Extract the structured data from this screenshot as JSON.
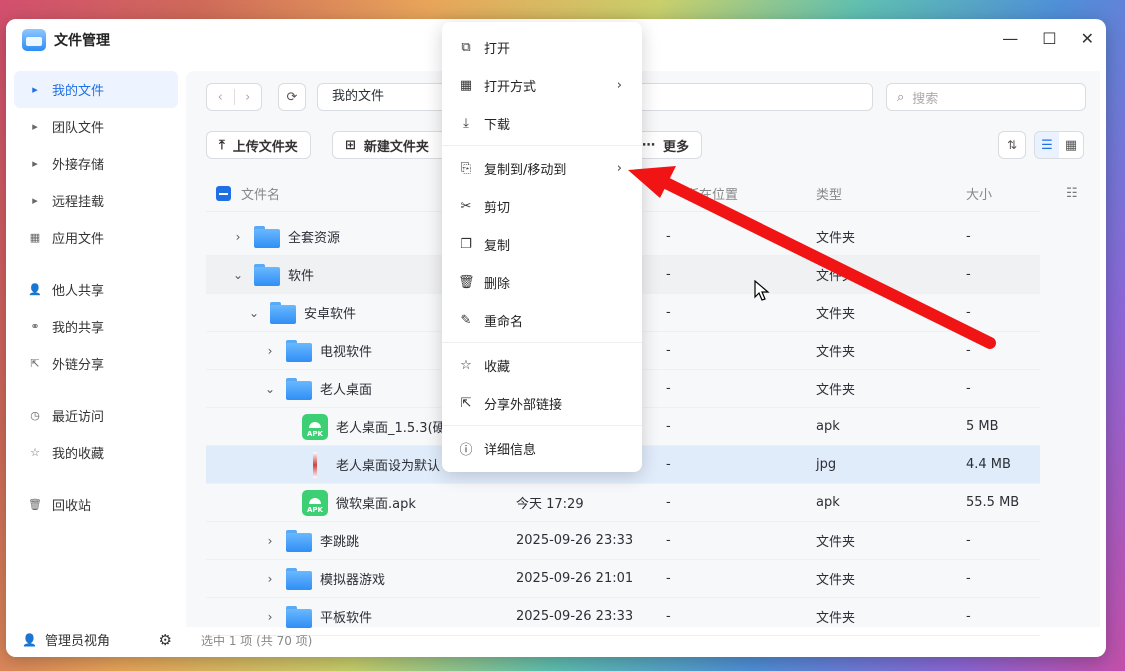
{
  "app": {
    "title": "文件管理"
  },
  "sidebar": {
    "items": [
      {
        "label": "我的文件",
        "icon": "caret-right-icon",
        "active": true
      },
      {
        "label": "团队文件",
        "icon": "caret-right-icon"
      },
      {
        "label": "外接存储",
        "icon": "caret-right-icon"
      },
      {
        "label": "远程挂载",
        "icon": "caret-right-icon"
      },
      {
        "label": "应用文件",
        "icon": "apps-grid-icon"
      },
      {
        "label": "他人共享",
        "icon": "user-icon"
      },
      {
        "label": "我的共享",
        "icon": "share-icon"
      },
      {
        "label": "外链分享",
        "icon": "external-link-icon"
      },
      {
        "label": "最近访问",
        "icon": "clock-icon"
      },
      {
        "label": "我的收藏",
        "icon": "star-icon"
      },
      {
        "label": "回收站",
        "icon": "trash-icon"
      }
    ],
    "footer": {
      "label": "管理员视角"
    }
  },
  "toolbar": {
    "path": "我的文件",
    "search_placeholder": "搜索",
    "upload_folder": "上传文件夹",
    "new_folder": "新建文件夹",
    "more": "更多"
  },
  "table": {
    "headers": {
      "name": "文件名",
      "location": "所在位置",
      "type": "类型",
      "size": "大小"
    },
    "rows": [
      {
        "indent": 0,
        "caret": "›",
        "kind": "folder",
        "name": "全套资源",
        "date": "",
        "loc": "-",
        "type": "文件夹",
        "size": "-"
      },
      {
        "indent": 0,
        "caret": "⌄",
        "kind": "folder",
        "name": "软件",
        "date": "",
        "loc": "-",
        "type": "文件夹",
        "size": "-",
        "state": "hover"
      },
      {
        "indent": 1,
        "caret": "⌄",
        "kind": "folder",
        "name": "安卓软件",
        "date": "",
        "loc": "-",
        "type": "文件夹",
        "size": "-"
      },
      {
        "indent": 2,
        "caret": "›",
        "kind": "folder",
        "name": "电视软件",
        "date": "",
        "loc": "-",
        "type": "文件夹",
        "size": "-"
      },
      {
        "indent": 2,
        "caret": "⌄",
        "kind": "folder",
        "name": "老人桌面",
        "date": "",
        "loc": "-",
        "type": "文件夹",
        "size": "-"
      },
      {
        "indent": 3,
        "caret": "",
        "kind": "apk",
        "name": "老人桌面_1.5.3(硬",
        "date": "",
        "loc": "-",
        "type": "apk",
        "size": "5 MB"
      },
      {
        "indent": 3,
        "caret": "",
        "kind": "jpg",
        "name": "老人桌面设为默认",
        "date": "",
        "loc": "-",
        "type": "jpg",
        "size": "4.4 MB",
        "state": "sel"
      },
      {
        "indent": 3,
        "caret": "",
        "kind": "apk",
        "name": "微软桌面.apk",
        "date": "今天 17:29",
        "loc": "-",
        "type": "apk",
        "size": "55.5 MB"
      },
      {
        "indent": 2,
        "caret": "›",
        "kind": "folder",
        "name": "李跳跳",
        "date": "2025-09-26 23:33",
        "loc": "-",
        "type": "文件夹",
        "size": "-"
      },
      {
        "indent": 2,
        "caret": "›",
        "kind": "folder",
        "name": "模拟器游戏",
        "date": "2025-09-26 21:01",
        "loc": "-",
        "type": "文件夹",
        "size": "-"
      },
      {
        "indent": 2,
        "caret": "›",
        "kind": "folder",
        "name": "平板软件",
        "date": "2025-09-26 23:33",
        "loc": "-",
        "type": "文件夹",
        "size": "-"
      }
    ]
  },
  "apk_badge": "APK",
  "status": "选中 1 项 (共 70 项)",
  "context_menu": [
    {
      "label": "打开",
      "icon": "open-external-icon"
    },
    {
      "label": "打开方式",
      "icon": "apps-icon",
      "submenu": true
    },
    {
      "label": "下载",
      "icon": "download-icon"
    },
    {
      "sep": true
    },
    {
      "label": "复制到/移动到",
      "icon": "copy-move-icon",
      "submenu": true
    },
    {
      "label": "剪切",
      "icon": "scissors-icon"
    },
    {
      "label": "复制",
      "icon": "copy-icon"
    },
    {
      "label": "删除",
      "icon": "trash-icon"
    },
    {
      "label": "重命名",
      "icon": "pencil-icon"
    },
    {
      "sep": true
    },
    {
      "label": "收藏",
      "icon": "star-icon"
    },
    {
      "label": "分享外部链接",
      "icon": "share-link-icon"
    },
    {
      "sep": true
    },
    {
      "label": "详细信息",
      "icon": "info-icon"
    }
  ],
  "colors": {
    "accent": "#1f6fe5",
    "arrow": "#f01414"
  }
}
